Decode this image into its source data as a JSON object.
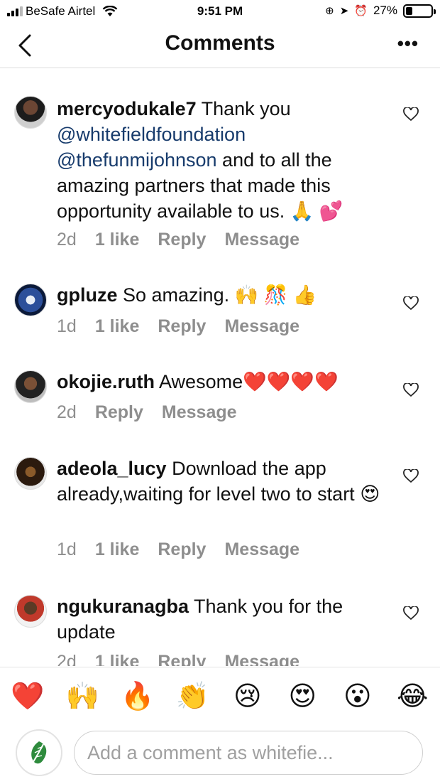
{
  "status_bar": {
    "carrier": "BeSafe Airtel",
    "time": "9:51 PM",
    "battery": "27%",
    "battery_level": 0.27,
    "icons": [
      "signal-icon",
      "wifi-icon",
      "screen-lock-icon",
      "location-icon",
      "alarm-icon",
      "battery-icon"
    ]
  },
  "header": {
    "title": "Comments",
    "more": "•••"
  },
  "comments": [
    {
      "username": "mercyodukale7",
      "text": " Thank you ",
      "mention1": "@whitefieldfoundation",
      "mention2": "@thefunmijohnson",
      "text_after": " and to all the amazing partners that made this opportunity available to us. 🙏 💕",
      "age": "2d",
      "likes": "1 like",
      "reply": "Reply",
      "message": "Message"
    },
    {
      "username": "gpluze",
      "text": " So amazing. 🙌 🎊 👍",
      "age": "1d",
      "likes": "1 like",
      "reply": "Reply",
      "message": "Message"
    },
    {
      "username": "okojie.ruth",
      "text": " Awesome❤️❤️❤️❤️",
      "age": "2d",
      "reply": "Reply",
      "message": "Message"
    },
    {
      "username": "adeola_lucy",
      "text": " Download the app already,waiting for level two to start 😍",
      "age": "1d",
      "likes": "1 like",
      "reply": "Reply",
      "message": "Message"
    },
    {
      "username": "ngukuranagba",
      "text": " Thank you for the update",
      "age": "2d",
      "likes": "1 like",
      "reply": "Reply",
      "message": "Message"
    }
  ],
  "emoji_bar": [
    "❤️",
    "🙌",
    "🔥",
    "👏",
    "😢",
    "😍",
    "😮",
    "😂"
  ],
  "composer": {
    "placeholder": "Add a comment as whitefie..."
  }
}
